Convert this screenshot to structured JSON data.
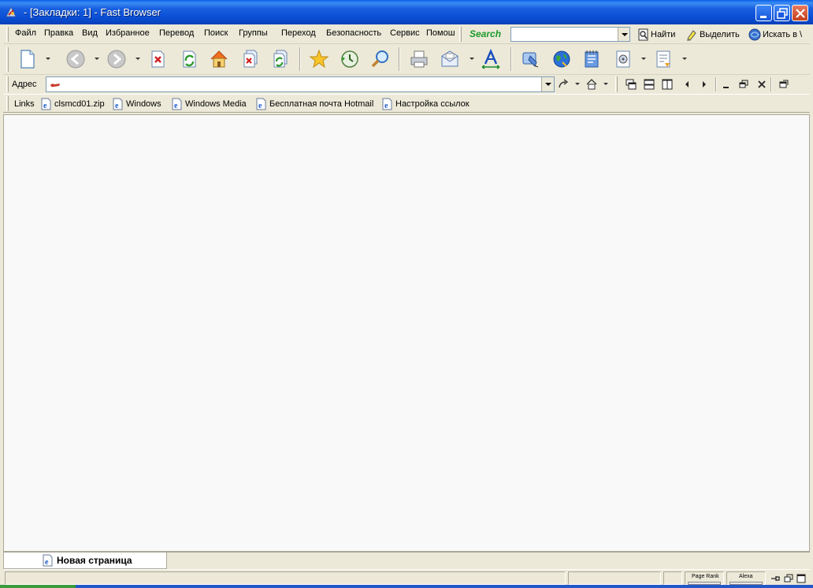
{
  "window": {
    "title": " - [Закладки: 1] - Fast Browser"
  },
  "menu": {
    "items": [
      "Файл",
      "Правка",
      "Вид",
      "Избранное",
      "Перевод",
      "Поиск",
      "Группы",
      "Переход",
      "Безопасность",
      "Сервис",
      "Помош"
    ]
  },
  "search": {
    "logo": "Search",
    "value": "",
    "find_label": "Найти",
    "highlight_label": "Выделить",
    "search_in_label": "Искать в \\"
  },
  "toolbar": {
    "buttons": [
      "new-page",
      "back",
      "forward",
      "stop",
      "refresh",
      "home",
      "stop-all",
      "refresh-all",
      "favorites",
      "history",
      "search",
      "print",
      "mail",
      "font",
      "tools",
      "browser-globe",
      "notes",
      "media",
      "page-properties"
    ]
  },
  "address": {
    "label": "Адрес",
    "value": ""
  },
  "links": {
    "label": "Links",
    "items": [
      "clsmcd01.zip",
      "Windows",
      "Windows Media",
      "Бесплатная почта Hotmail",
      "Настройка ссылок"
    ]
  },
  "tabs": [
    {
      "label": "Новая страница"
    }
  ],
  "status": {
    "page_rank_label": "Page Rank",
    "alexa_label": "Alexa"
  }
}
